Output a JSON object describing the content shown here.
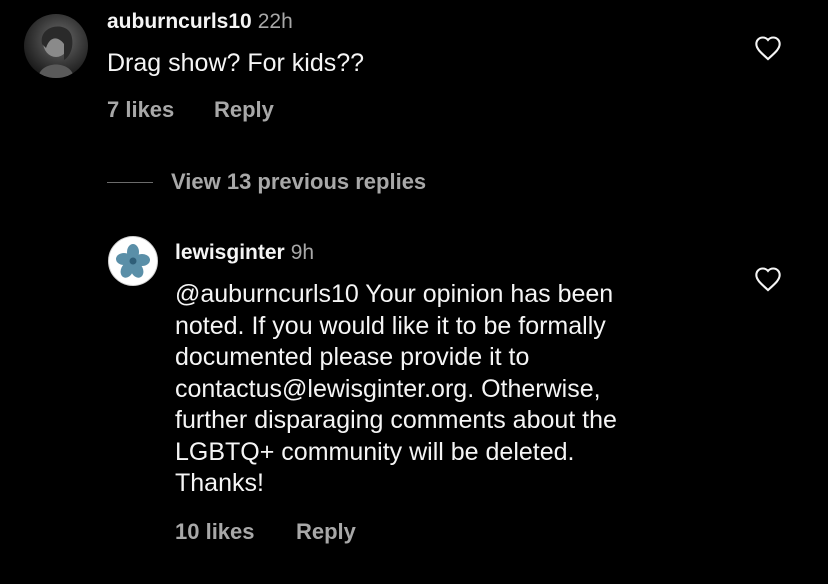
{
  "comment": {
    "username": "auburncurls10",
    "time": "22h",
    "text": "Drag show? For kids??",
    "likes": "7 likes",
    "reply": "Reply",
    "like_icon": "heart-outline-icon"
  },
  "thread": {
    "view_replies": "View 13 previous replies"
  },
  "reply": {
    "username": "lewisginter",
    "time": "9h",
    "lines": [
      "@auburncurls10 Your opinion has been",
      "noted. If you would like it to be formally",
      "documented please provide it to",
      "contactus@lewisginter.org. Otherwise,",
      "further disparaging comments about the",
      "LGBTQ+ community will be deleted.",
      "Thanks!"
    ],
    "likes": "10 likes",
    "reply": "Reply",
    "like_icon": "heart-outline-icon"
  },
  "colors": {
    "background": "#000000",
    "primary_text": "#f5f5f5",
    "secondary_text": "#a8a8a8",
    "logo_blue": "#5a8fa8"
  }
}
